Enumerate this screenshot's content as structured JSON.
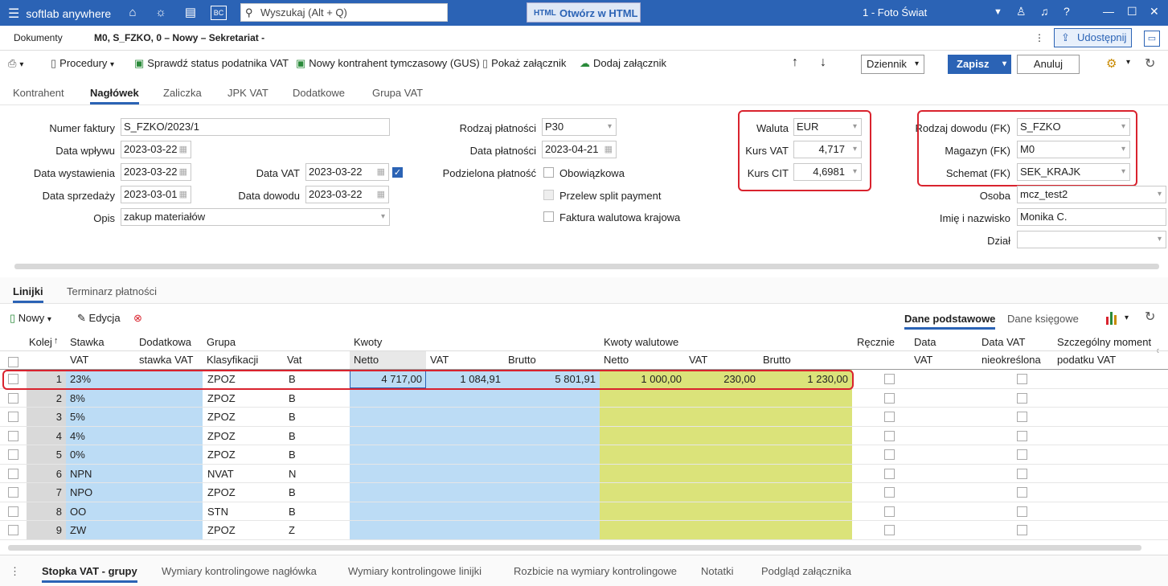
{
  "app": {
    "brand": "softlab anywhere",
    "search_placeholder": "Wyszukaj (Alt + Q)",
    "html_button": "Otwórz w HTML",
    "company": "1 - Foto Świat",
    "bc_label": "BC",
    "html_icon_text": "HTML"
  },
  "doc_tabs": {
    "dokumenty": "Dokumenty",
    "current": "M0, S_FZKO, 0 – Nowy – Sekretariat -",
    "share": "Udostępnij"
  },
  "toolbar": {
    "procedury": "Procedury",
    "status": "Sprawdź status podatnika VAT",
    "gus": "Nowy kontrahent tymczasowy (GUS)",
    "pokaz": "Pokaż załącznik",
    "dodaj": "Dodaj załącznik",
    "dziennik": "Dziennik",
    "zapisz": "Zapisz",
    "anuluj": "Anuluj"
  },
  "tabs": [
    "Kontrahent",
    "Nagłówek",
    "Zaliczka",
    "JPK VAT",
    "Dodatkowe",
    "Grupa VAT"
  ],
  "form": {
    "numer_faktury_label": "Numer faktury",
    "numer_faktury": "S_FZKO/2023/1",
    "data_wplywu_label": "Data wpływu",
    "data_wplywu": "2023-03-22",
    "data_wystawienia_label": "Data wystawienia",
    "data_wystawienia": "2023-03-22",
    "data_vat_label": "Data VAT",
    "data_vat": "2023-03-22",
    "data_sprzedazy_label": "Data sprzedaży",
    "data_sprzedazy": "2023-03-01",
    "data_dowodu_label": "Data dowodu",
    "data_dowodu": "2023-03-22",
    "opis_label": "Opis",
    "opis": "zakup materiałów",
    "rodzaj_platnosci_label": "Rodzaj płatności",
    "rodzaj_platnosci": "P30",
    "data_platnosci_label": "Data płatności",
    "data_platnosci": "2023-04-21",
    "podzielona_label": "Podzielona płatność",
    "obowiazkowa": "Obowiązkowa",
    "split": "Przelew split payment",
    "walutowa": "Faktura walutowa krajowa",
    "waluta_label": "Waluta",
    "waluta": "EUR",
    "kurs_vat_label": "Kurs VAT",
    "kurs_vat": "4,717",
    "kurs_cit_label": "Kurs CIT",
    "kurs_cit": "4,6981",
    "rodzaj_dowodu_label": "Rodzaj dowodu (FK)",
    "rodzaj_dowodu": "S_FZKO",
    "magazyn_label": "Magazyn (FK)",
    "magazyn": "M0",
    "schemat_label": "Schemat (FK)",
    "schemat": "SEK_KRAJK",
    "osoba_label": "Osoba",
    "osoba": "mcz_test2",
    "imie_label": "Imię i nazwisko",
    "imie": "Monika C.",
    "dzial_label": "Dział",
    "dzial": ""
  },
  "lower_tabs": [
    "Linijki",
    "Terminarz płatności"
  ],
  "grid_toolbar": {
    "nowy": "Nowy",
    "edycja": "Edycja",
    "dane_podstawowe": "Dane podstawowe",
    "dane_ksiegowe": "Dane księgowe"
  },
  "grid_headers": {
    "kolej": "Kolej",
    "stawka": "Stawka",
    "stawka_vat": "VAT",
    "dodatkowa": "Dodatkowa",
    "dodatkowa2": "stawka VAT",
    "grupa": "Grupa",
    "klasyfikacji": "Klasyfikacji",
    "vat": "Vat",
    "kwoty": "Kwoty",
    "netto": "Netto",
    "k_vat": "VAT",
    "brutto": "Brutto",
    "kwoty_wal": "Kwoty walutowe",
    "w_netto": "Netto",
    "w_vat": "VAT",
    "w_brutto": "Brutto",
    "recznie": "Ręcznie",
    "data": "Data",
    "data2": "VAT",
    "data_vat_n": "Data VAT",
    "data_vat_n2": "nieokreślona",
    "szczegolny": "Szczególny moment",
    "szczegolny2": "podatku VAT"
  },
  "rows": [
    {
      "n": "1",
      "stawka": "23%",
      "klas": "ZPOZ",
      "vat": "B",
      "netto": "4 717,00",
      "kvat": "1 084,91",
      "brutto": "5 801,91",
      "wnetto": "1 000,00",
      "wvat": "230,00",
      "wbrutto": "1 230,00"
    },
    {
      "n": "2",
      "stawka": "8%",
      "klas": "ZPOZ",
      "vat": "B",
      "netto": "",
      "kvat": "",
      "brutto": "",
      "wnetto": "",
      "wvat": "",
      "wbrutto": ""
    },
    {
      "n": "3",
      "stawka": "5%",
      "klas": "ZPOZ",
      "vat": "B",
      "netto": "",
      "kvat": "",
      "brutto": "",
      "wnetto": "",
      "wvat": "",
      "wbrutto": ""
    },
    {
      "n": "4",
      "stawka": "4%",
      "klas": "ZPOZ",
      "vat": "B",
      "netto": "",
      "kvat": "",
      "brutto": "",
      "wnetto": "",
      "wvat": "",
      "wbrutto": ""
    },
    {
      "n": "5",
      "stawka": "0%",
      "klas": "ZPOZ",
      "vat": "B",
      "netto": "",
      "kvat": "",
      "brutto": "",
      "wnetto": "",
      "wvat": "",
      "wbrutto": ""
    },
    {
      "n": "6",
      "stawka": "NPN",
      "klas": "NVAT",
      "vat": "N",
      "netto": "",
      "kvat": "",
      "brutto": "",
      "wnetto": "",
      "wvat": "",
      "wbrutto": ""
    },
    {
      "n": "7",
      "stawka": "NPO",
      "klas": "ZPOZ",
      "vat": "B",
      "netto": "",
      "kvat": "",
      "brutto": "",
      "wnetto": "",
      "wvat": "",
      "wbrutto": ""
    },
    {
      "n": "8",
      "stawka": "OO",
      "klas": "STN",
      "vat": "B",
      "netto": "",
      "kvat": "",
      "brutto": "",
      "wnetto": "",
      "wvat": "",
      "wbrutto": ""
    },
    {
      "n": "9",
      "stawka": "ZW",
      "klas": "ZPOZ",
      "vat": "Z",
      "netto": "",
      "kvat": "",
      "brutto": "",
      "wnetto": "",
      "wvat": "",
      "wbrutto": ""
    }
  ],
  "bottom_tabs": [
    "Stopka VAT - grupy",
    "Wymiary kontrolingowe nagłówka",
    "Wymiary kontrolingowe linijki",
    "Rozbicie na wymiary kontrolingowe",
    "Notatki",
    "Podgląd załącznika"
  ],
  "colors": {
    "accent": "#2b63b5",
    "blue_fill": "#bcdcf5",
    "yellow_fill": "#dbe37a",
    "grey_col": "#d9d9d9",
    "highlight": "#d9232e"
  }
}
